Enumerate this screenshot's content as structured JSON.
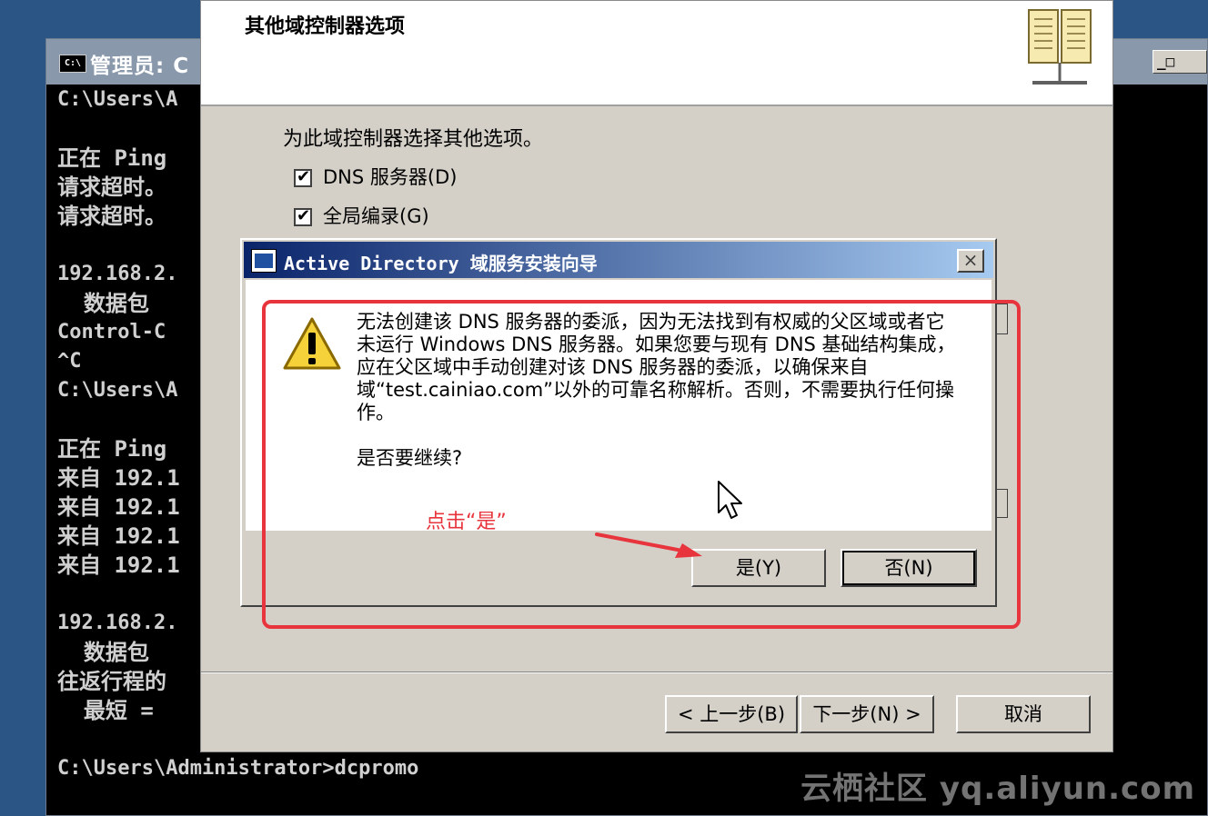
{
  "console": {
    "title": "管理员: C",
    "icon_text": "C:\\",
    "window_buttons": "_□",
    "lines": [
      "C:\\Users\\A",
      "",
      "正在 Ping",
      "请求超时。",
      "请求超时。",
      "",
      "192.168.2.",
      "  数据包",
      "Control-C",
      "^C",
      "C:\\Users\\A",
      "",
      "正在 Ping",
      "来自 192.1",
      "来自 192.1",
      "来自 192.1",
      "来自 192.1",
      "",
      "192.168.2.",
      "  数据包",
      "往返行程的",
      "  最短 =",
      "",
      "C:\\Users\\Administrator>dcpromo"
    ]
  },
  "wizard": {
    "title": "其他域控制器选项",
    "description": "为此域控制器选择其他选项。",
    "options": [
      {
        "label": "DNS 服务器(D)",
        "checked": true
      },
      {
        "label": "全局编录(G)",
        "checked": true
      }
    ],
    "buttons": {
      "back": "< 上一步(B)",
      "next": "下一步(N) >",
      "cancel": "取消"
    }
  },
  "dialog": {
    "title": "Active Directory 域服务安装向导",
    "close": "×",
    "message": "无法创建该 DNS 服务器的委派，因为无法找到有权威的父区域或者它未运行 Windows DNS 服务器。如果您要与现有 DNS 基础结构集成，应在父区域中手动创建对该 DNS 服务器的委派，以确保来自域“test.cainiao.com”以外的可靠名称解析。否则，不需要执行任何操作。",
    "question": "是否要继续?",
    "buttons": {
      "yes": "是(Y)",
      "no": "否(N)"
    }
  },
  "annotation": {
    "text": "点击“是”",
    "color": "#e8343c"
  },
  "watermark": "云栖社区 yq.aliyun.com"
}
